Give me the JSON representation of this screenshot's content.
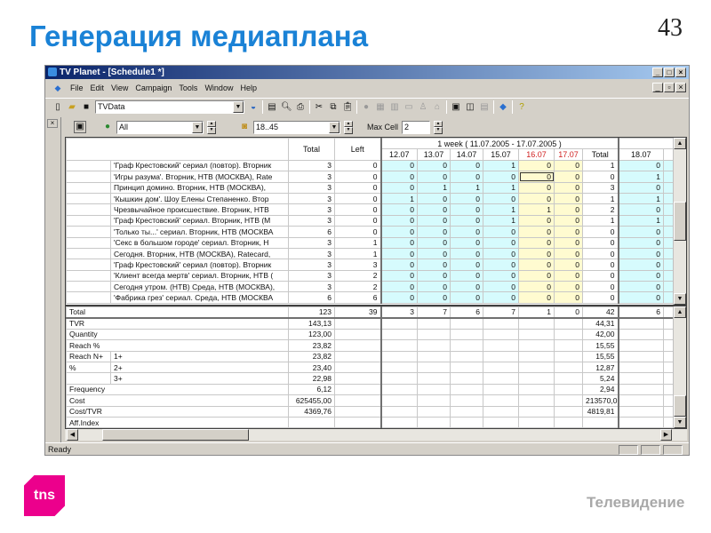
{
  "slide": {
    "title": "Генерация медиаплана",
    "page": "43",
    "footer": "Телевидение",
    "logo": "tns"
  },
  "window": {
    "title": "TV Planet - [Schedule1 *]",
    "status": "Ready"
  },
  "menu": [
    "File",
    "Edit",
    "View",
    "Campaign",
    "Tools",
    "Window",
    "Help"
  ],
  "toolbar": {
    "database": "TVData"
  },
  "toolbar2": {
    "filter": "All",
    "time": "18..45",
    "maxcell_label": "Max Cell",
    "maxcell": "2"
  },
  "grid": {
    "header_total": "Total",
    "header_left": "Left",
    "week": "1 week  ( 11.07.2005 - 17.07.2005 )",
    "days": [
      "12.07",
      "13.07",
      "14.07",
      "15.07",
      "16.07",
      "17.07"
    ],
    "weekend": [
      false,
      false,
      false,
      false,
      true,
      true
    ],
    "week_total": "Total",
    "next_day": "18.07",
    "rows": [
      {
        "name": "'Граф Крестовский' сериал (повтор). Вторник",
        "total": "3",
        "left": "0",
        "d": [
          "0",
          "0",
          "0",
          "1",
          "0",
          "0"
        ],
        "wt": "1",
        "n": "0"
      },
      {
        "name": "'Игры разума'. Вторник, НТВ (МОСКВА), Rate",
        "total": "3",
        "left": "0",
        "d": [
          "0",
          "0",
          "0",
          "0",
          "0",
          "0"
        ],
        "wt": "0",
        "n": "1"
      },
      {
        "name": "Принцип домино. Вторник, НТВ (МОСКВА),",
        "total": "3",
        "left": "0",
        "d": [
          "0",
          "1",
          "1",
          "1",
          "0",
          "0"
        ],
        "wt": "3",
        "n": "0"
      },
      {
        "name": "'Кышкин дом'. Шоу Елены Степаненко. Втор",
        "total": "3",
        "left": "0",
        "d": [
          "1",
          "0",
          "0",
          "0",
          "0",
          "0"
        ],
        "wt": "1",
        "n": "1"
      },
      {
        "name": "Чрезвычайное происшествие. Вторник, НТВ",
        "total": "3",
        "left": "0",
        "d": [
          "0",
          "0",
          "0",
          "1",
          "1",
          "0"
        ],
        "wt": "2",
        "n": "0"
      },
      {
        "name": "'Граф Крестовский' сериал. Вторник, НТВ (М",
        "total": "3",
        "left": "0",
        "d": [
          "0",
          "0",
          "0",
          "1",
          "0",
          "0"
        ],
        "wt": "1",
        "n": "1"
      },
      {
        "name": "'Только ты...' сериал. Вторник, НТВ (МОСКВА",
        "total": "6",
        "left": "0",
        "d": [
          "0",
          "0",
          "0",
          "0",
          "0",
          "0"
        ],
        "wt": "0",
        "n": "0"
      },
      {
        "name": "'Секс в большом городе' сериал. Вторник, Н",
        "total": "3",
        "left": "1",
        "d": [
          "0",
          "0",
          "0",
          "0",
          "0",
          "0"
        ],
        "wt": "0",
        "n": "0"
      },
      {
        "name": "Сегодня. Вторник, НТВ (МОСКВА), Ratecard,",
        "total": "3",
        "left": "1",
        "d": [
          "0",
          "0",
          "0",
          "0",
          "0",
          "0"
        ],
        "wt": "0",
        "n": "0"
      },
      {
        "name": "'Граф Крестовский' сериал (повтор). Вторник",
        "total": "3",
        "left": "3",
        "d": [
          "0",
          "0",
          "0",
          "0",
          "0",
          "0"
        ],
        "wt": "0",
        "n": "0"
      },
      {
        "name": "'Клиент всегда мертв' сериал. Вторник, НТВ (",
        "total": "3",
        "left": "2",
        "d": [
          "0",
          "0",
          "0",
          "0",
          "0",
          "0"
        ],
        "wt": "0",
        "n": "0"
      },
      {
        "name": "Сегодня утром. (НТВ) Среда, НТВ (МОСКВА),",
        "total": "3",
        "left": "2",
        "d": [
          "0",
          "0",
          "0",
          "0",
          "0",
          "0"
        ],
        "wt": "0",
        "n": "0"
      },
      {
        "name": "'Фабрика грез' сериал. Среда, НТВ (МОСКВА",
        "total": "6",
        "left": "6",
        "d": [
          "0",
          "0",
          "0",
          "0",
          "0",
          "0"
        ],
        "wt": "0",
        "n": "0"
      }
    ],
    "selected": {
      "row": 1,
      "day": 4
    }
  },
  "summary": {
    "total": {
      "label": "Total",
      "total": "123",
      "left": "39",
      "d": [
        "3",
        "7",
        "6",
        "7",
        "1",
        "0"
      ],
      "wt": "42",
      "n": "6"
    },
    "rows": [
      {
        "label": "TVR",
        "sub": "",
        "total": "143,13",
        "wt": "44,31"
      },
      {
        "label": "Quantity",
        "sub": "",
        "total": "123,00",
        "wt": "42,00"
      },
      {
        "label": "Reach %",
        "sub": "",
        "total": "23,82",
        "wt": "15,55"
      },
      {
        "label": "Reach N+",
        "sub": "1+",
        "total": "23,82",
        "wt": "15,55"
      },
      {
        "label": "%",
        "sub": "2+",
        "total": "23,40",
        "wt": "12,87"
      },
      {
        "label": "",
        "sub": "3+",
        "total": "22,98",
        "wt": "5,24"
      },
      {
        "label": "Frequency",
        "sub": "",
        "total": "6,12",
        "wt": "2,94"
      },
      {
        "label": "Cost",
        "sub": "",
        "total": "625455,00",
        "wt": "213570,0"
      },
      {
        "label": "Cost/TVR",
        "sub": "",
        "total": "4369,76",
        "wt": "4819,81"
      },
      {
        "label": "Aff.Index",
        "sub": "",
        "total": "",
        "wt": ""
      }
    ]
  }
}
